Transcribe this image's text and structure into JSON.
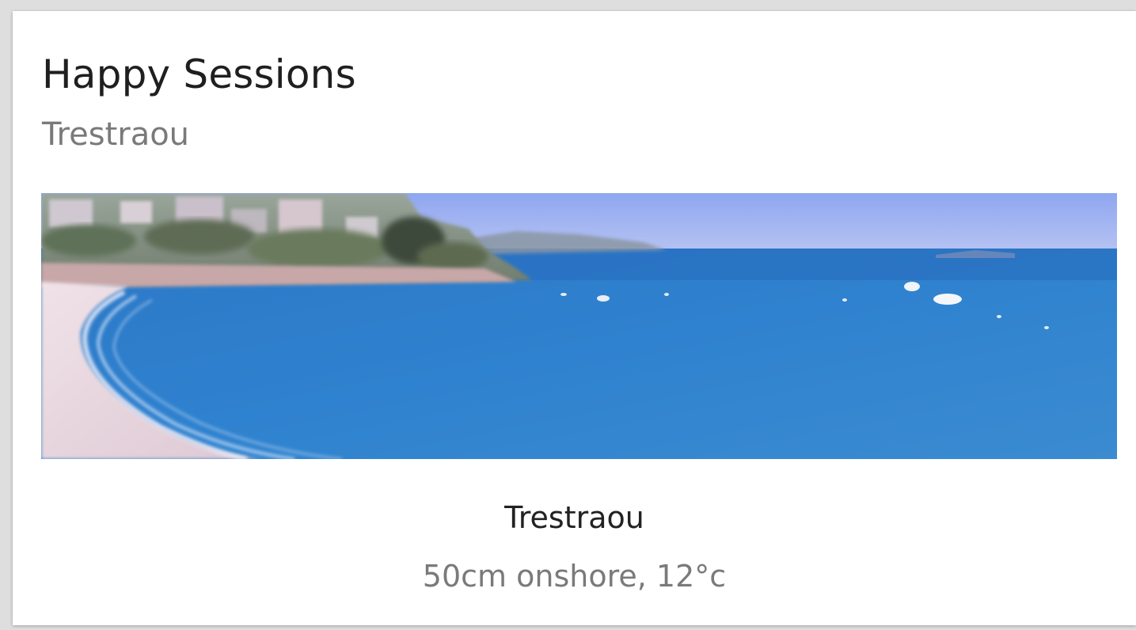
{
  "card": {
    "title": "Happy Sessions",
    "subtitle": "Trestraou"
  },
  "webcam": {
    "alt": "Trestraou beach webcam",
    "location_name": "Trestraou",
    "conditions": "50cm onshore, 12°c"
  },
  "colors": {
    "title": "#1f1f1f",
    "subtitle": "#7a7a7a",
    "card_background": "#ffffff",
    "sea": "#2f7cc2",
    "sky": "#9fb3ee",
    "sand": "#e7d6dc"
  }
}
